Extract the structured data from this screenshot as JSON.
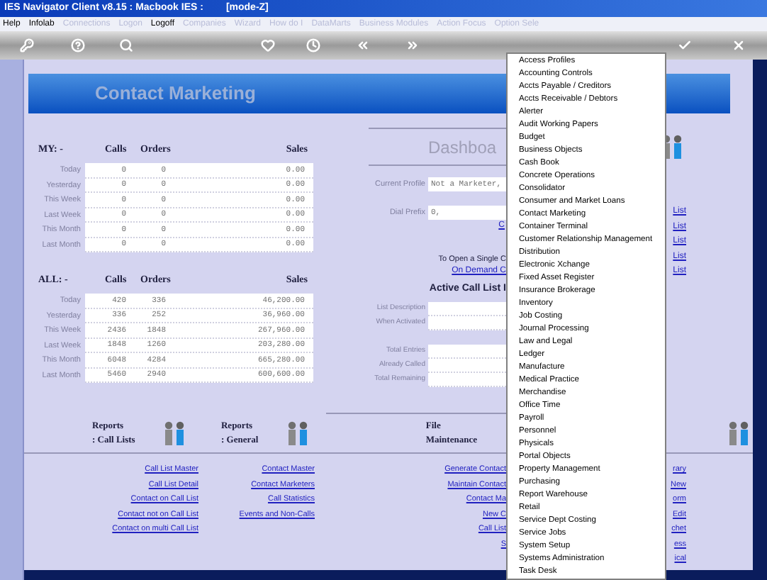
{
  "window": {
    "title": "IES Navigator Client v8.15 : Macbook IES :",
    "mode": "[mode-Z]"
  },
  "menu": [
    {
      "label": "Help",
      "disabled": false
    },
    {
      "label": "Infolab",
      "disabled": false
    },
    {
      "label": "Connections",
      "disabled": true
    },
    {
      "label": "Logon",
      "disabled": true
    },
    {
      "label": "Logoff",
      "disabled": false
    },
    {
      "label": "Companies",
      "disabled": true
    },
    {
      "label": "Wizard",
      "disabled": true
    },
    {
      "label": "How do I",
      "disabled": true
    },
    {
      "label": "DataMarts",
      "disabled": true
    },
    {
      "label": "Business Modules",
      "disabled": true
    },
    {
      "label": "Action Focus",
      "disabled": true
    },
    {
      "label": "Option Sele",
      "disabled": true
    }
  ],
  "page_title": "Contact Marketing",
  "stat_tables": [
    {
      "heading": "MY: -",
      "columns": [
        "Calls",
        "Orders",
        "Sales"
      ],
      "rows": [
        {
          "label": "Today",
          "calls": "0",
          "orders": "0",
          "sales": "0.00"
        },
        {
          "label": "Yesterday",
          "calls": "0",
          "orders": "0",
          "sales": "0.00"
        },
        {
          "label": "This Week",
          "calls": "0",
          "orders": "0",
          "sales": "0.00"
        },
        {
          "label": "Last Week",
          "calls": "0",
          "orders": "0",
          "sales": "0.00"
        },
        {
          "label": "This Month",
          "calls": "0",
          "orders": "0",
          "sales": "0.00"
        },
        {
          "label": "Last Month",
          "calls": "0",
          "orders": "0",
          "sales": "0.00"
        }
      ]
    },
    {
      "heading": "ALL: -",
      "columns": [
        "Calls",
        "Orders",
        "Sales"
      ],
      "rows": [
        {
          "label": "Today",
          "calls": "420",
          "orders": "336",
          "sales": "46,200.00"
        },
        {
          "label": "Yesterday",
          "calls": "336",
          "orders": "252",
          "sales": "36,960.00"
        },
        {
          "label": "This Week",
          "calls": "2436",
          "orders": "1848",
          "sales": "267,960.00"
        },
        {
          "label": "Last Week",
          "calls": "1848",
          "orders": "1260",
          "sales": "203,280.00"
        },
        {
          "label": "This Month",
          "calls": "6048",
          "orders": "4284",
          "sales": "665,280.00"
        },
        {
          "label": "Last Month",
          "calls": "5460",
          "orders": "2940",
          "sales": "600,600.00"
        }
      ]
    }
  ],
  "dashboard": {
    "title": "Dashboa",
    "fields": [
      {
        "label": "Current Profile",
        "value": "Not a Marketer,"
      },
      {
        "label": "Dial Prefix",
        "value": "0,"
      }
    ],
    "link": "C",
    "open_single": "To Open a Single C",
    "on_demand_link": "On Demand C",
    "active_call_list": {
      "title": "Active Call List I",
      "groups": [
        [
          "List Description",
          "When Activated"
        ],
        [
          "Total Entries",
          "Already Called",
          "Total Remaining"
        ]
      ]
    }
  },
  "right_links": [
    "List",
    "List",
    "List",
    "List",
    "List"
  ],
  "sections": [
    {
      "title": "Reports",
      "subtitle": ": Call Lists",
      "links": [
        "Call List Master",
        "Call List Detail",
        "Contact on Call List",
        "Contact not on Call List",
        "Contact on multi Call List"
      ]
    },
    {
      "title": "Reports",
      "subtitle": ": General",
      "links": [
        "Contact Master",
        "Contact Marketers",
        "Call Statistics",
        "Events and Non-Calls"
      ]
    },
    {
      "title": "File",
      "subtitle": "Maintenance",
      "links": [
        "Generate Contact",
        "Maintain Contact",
        "Contact Ma",
        "New C",
        "Call List",
        "S"
      ]
    }
  ],
  "right_fragments": [
    "rary",
    "New",
    "orm",
    "Edit",
    "chet",
    "ess",
    "ical"
  ],
  "dropdown": [
    "Access Profiles",
    "Accounting Controls",
    "Accts Payable / Creditors",
    "Accts Receivable / Debtors",
    "Alerter",
    "Audit Working Papers",
    "Budget",
    "Business Objects",
    "Cash Book",
    "Concrete Operations",
    "Consolidator",
    "Consumer and Market Loans",
    "Contact Marketing",
    "Container Terminal",
    "Customer Relationship Management",
    "Distribution",
    "Electronic Xchange",
    "Fixed Asset Register",
    "Insurance Brokerage",
    "Inventory",
    "Job Costing",
    "Journal Processing",
    "Law and Legal",
    "Ledger",
    "Manufacture",
    "Medical Practice",
    "Merchandise",
    "Office Time",
    "Payroll",
    "Personnel",
    "Physicals",
    "Portal Objects",
    "Property Management",
    "Purchasing",
    "Report Warehouse",
    "Retail",
    "Service Dept Costing",
    "Service Jobs",
    "System Setup",
    "Systems Administration",
    "Task Desk"
  ]
}
